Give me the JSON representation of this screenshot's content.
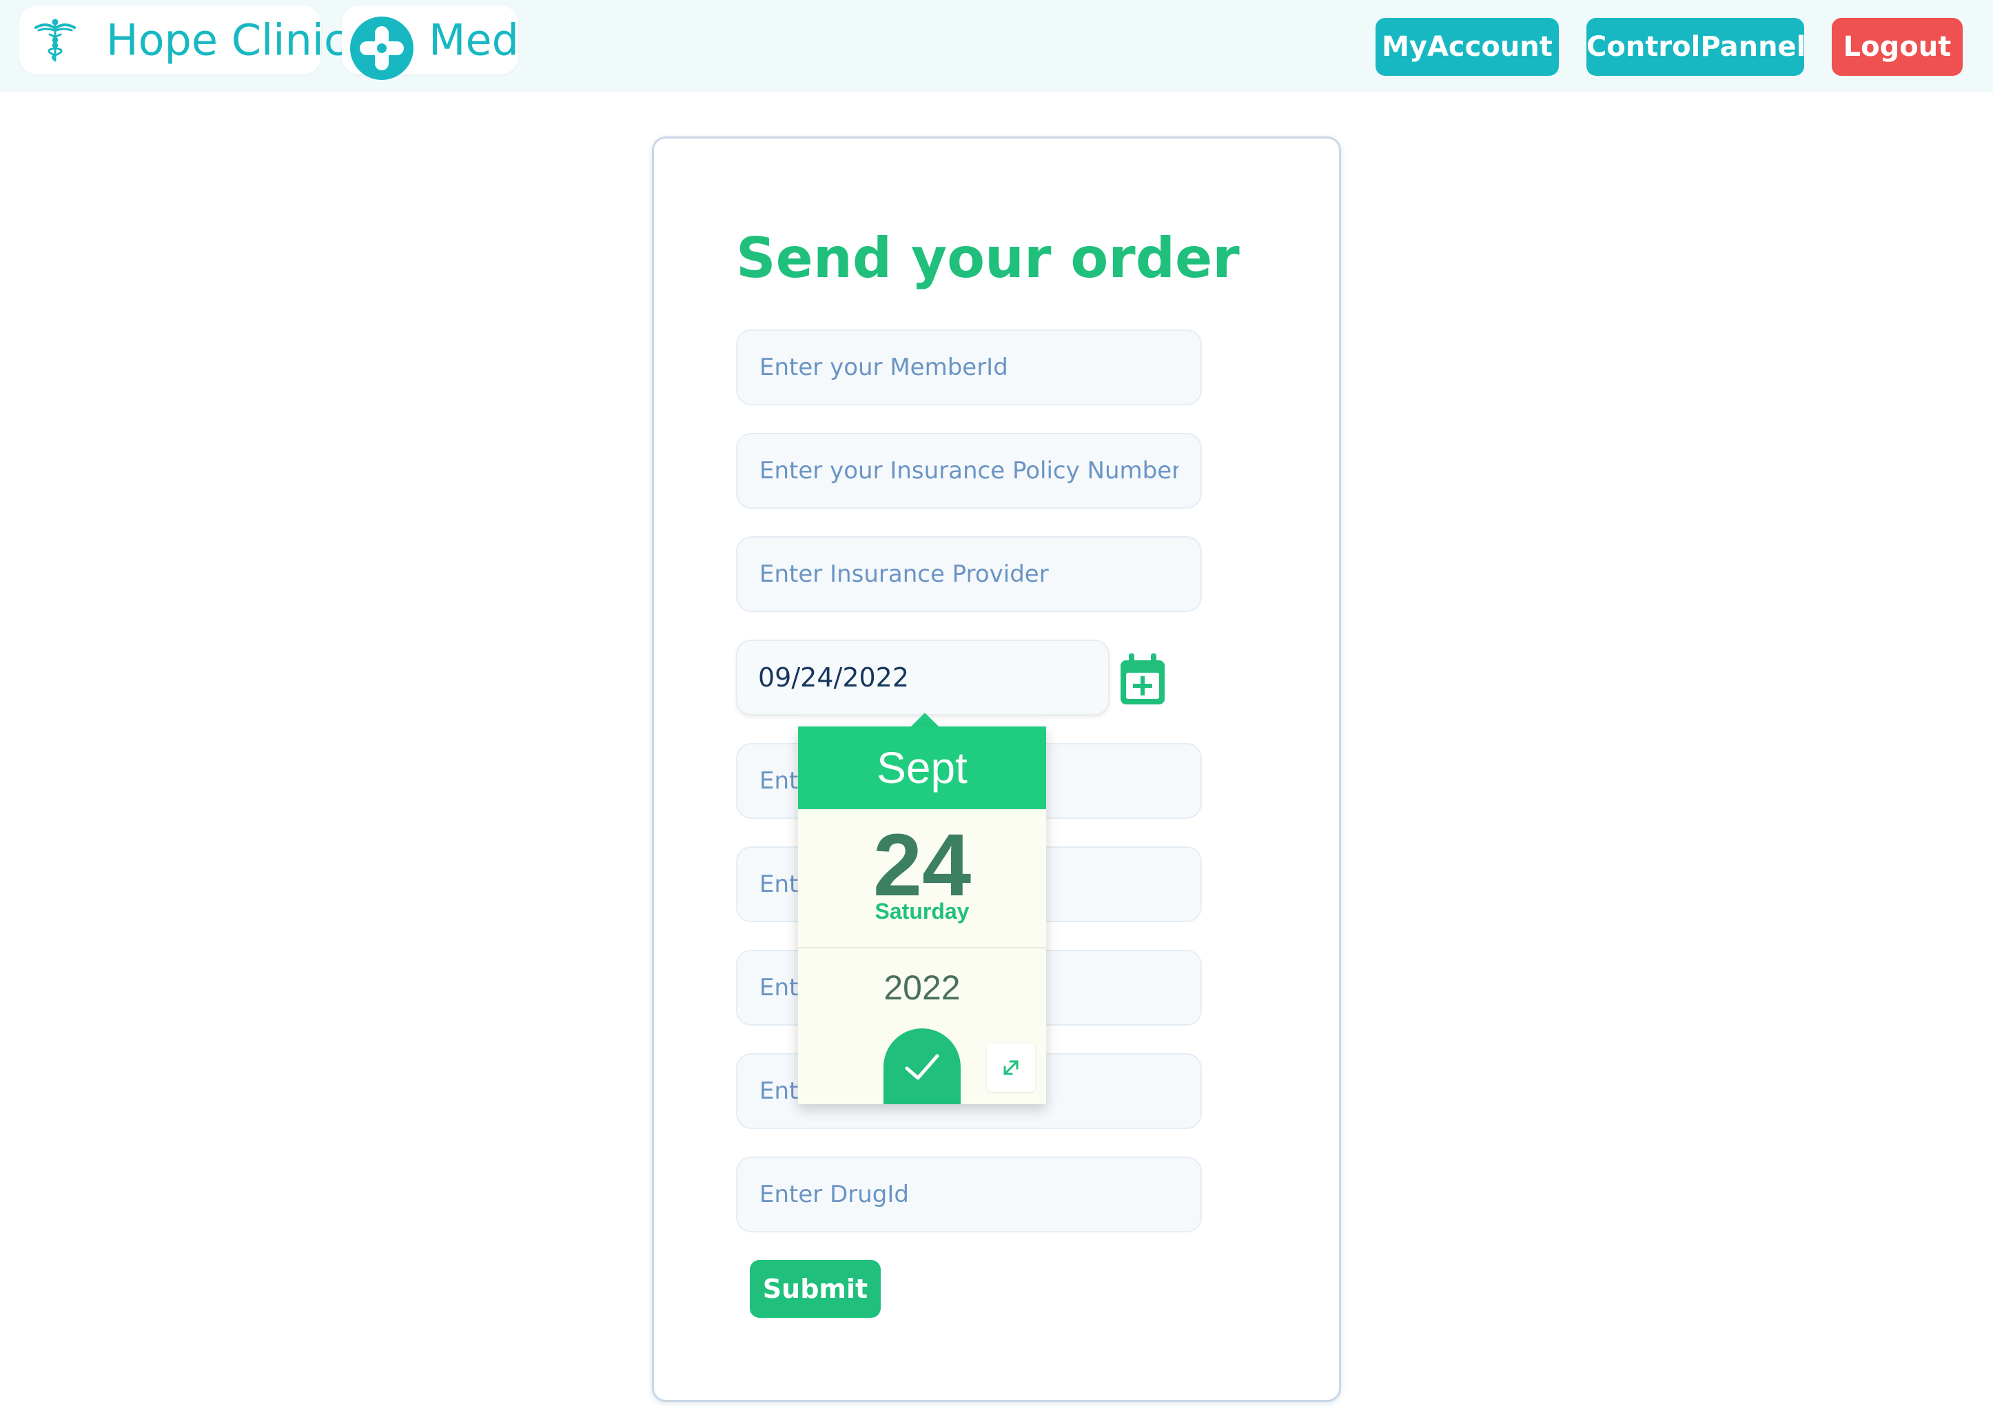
{
  "header": {
    "brand_primary": "Hope Clinic",
    "brand_secondary": "Med",
    "nav": {
      "my_account": "MyAccount",
      "control_panel": "ControlPannel",
      "logout": "Logout"
    }
  },
  "form": {
    "title": "Send your order",
    "fields": [
      {
        "placeholder": "Enter your MemberId",
        "value": ""
      },
      {
        "placeholder": "Enter your Insurance Policy Number",
        "value": ""
      },
      {
        "placeholder": "Enter Insurance Provider",
        "value": ""
      },
      {
        "placeholder": "Ente",
        "value": ""
      },
      {
        "placeholder": "Ente",
        "value": ""
      },
      {
        "placeholder": "Ente",
        "value": ""
      },
      {
        "placeholder": "Ente",
        "value": ""
      },
      {
        "placeholder": "Enter DrugId",
        "value": ""
      }
    ],
    "date_value": "09/24/2022",
    "submit_label": "Submit"
  },
  "date_picker": {
    "month": "Sept",
    "day": "24",
    "weekday": "Saturday",
    "year": "2022"
  },
  "colors": {
    "teal": "#17b8c2",
    "green": "#20c07c",
    "red": "#ef5050"
  },
  "icons": {
    "brand_primary": "caduceus-icon",
    "brand_secondary": "medical-plus-icon",
    "calendar": "calendar-plus-icon",
    "confirm": "check-icon",
    "expand": "expand-icon"
  }
}
